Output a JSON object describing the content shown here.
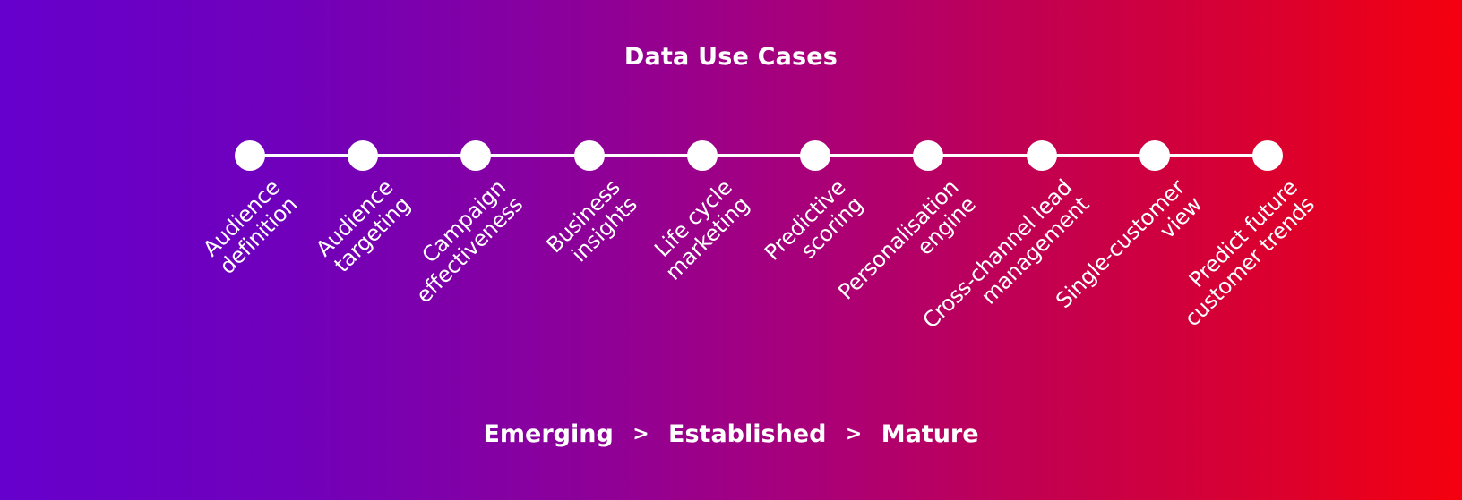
{
  "title": "Data Use Cases",
  "colors": {
    "gradient_start": "#6600cc",
    "gradient_end": "#f5000e",
    "foreground": "#ffffff"
  },
  "timeline": {
    "items": [
      {
        "lines": [
          "Audience",
          "definition"
        ]
      },
      {
        "lines": [
          "Audience",
          "targeting"
        ]
      },
      {
        "lines": [
          "Campaign",
          "effectiveness"
        ]
      },
      {
        "lines": [
          "Business",
          "insights"
        ]
      },
      {
        "lines": [
          "Life cycle",
          "marketing"
        ]
      },
      {
        "lines": [
          "Predictive",
          "scoring"
        ]
      },
      {
        "lines": [
          "Personalisation",
          "engine"
        ]
      },
      {
        "lines": [
          "Cross-channel lead",
          "management"
        ]
      },
      {
        "lines": [
          "Single-customer",
          "view"
        ]
      },
      {
        "lines": [
          "Predict future",
          "customer trends"
        ]
      }
    ]
  },
  "footer": {
    "stages": [
      "Emerging",
      "Established",
      "Mature"
    ],
    "separator": ">"
  }
}
